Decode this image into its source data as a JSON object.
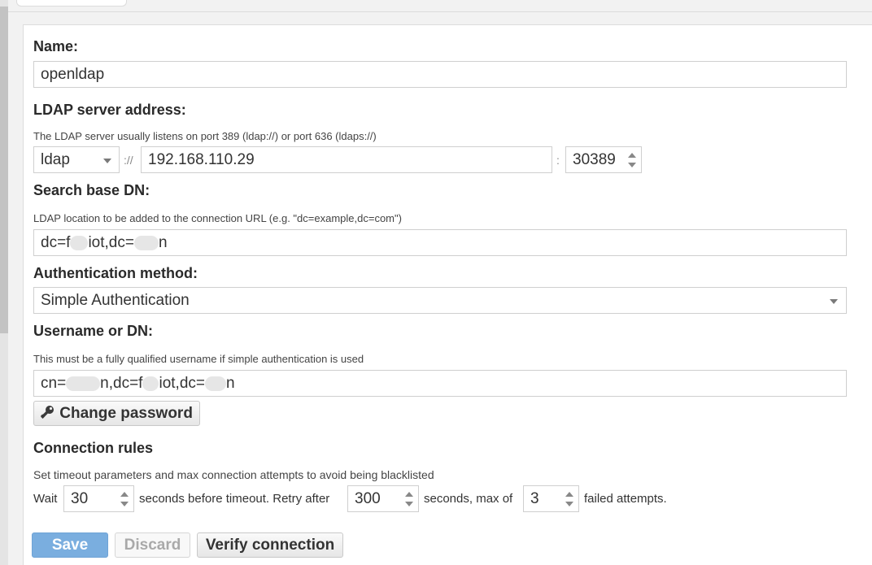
{
  "form": {
    "name_label": "Name:",
    "name_value": "openldap",
    "server_label": "LDAP server address:",
    "server_hint": "The LDAP server usually listens on port 389 (ldap://) or port 636 (ldaps://)",
    "protocol_value": "ldap",
    "protocol_sep": "://",
    "host_value": "192.168.110.29",
    "port_sep": ":",
    "port_value": "30389",
    "base_dn_label": "Search base DN:",
    "base_dn_hint": "LDAP location to be added to the connection URL (e.g. \"dc=example,dc=com\")",
    "base_dn_parts": [
      "dc=f",
      "iot,dc=",
      "n"
    ],
    "auth_label": "Authentication method:",
    "auth_value": "Simple Authentication",
    "username_label": "Username or DN:",
    "username_hint": "This must be a fully qualified username if simple authentication is used",
    "username_parts": [
      "cn=",
      "n,dc=f",
      "iot,dc=",
      "n"
    ],
    "change_password_label": "Change password"
  },
  "connection_rules": {
    "title": "Connection rules",
    "hint": "Set timeout parameters and max connection attempts to avoid being blacklisted",
    "wait_label": "Wait",
    "timeout_value": "30",
    "after_timeout_text": "seconds before timeout. Retry after",
    "retry_value": "300",
    "after_retry_text": "seconds, max of",
    "attempts_value": "3",
    "after_attempts_text": "failed attempts."
  },
  "actions": {
    "save_label": "Save",
    "discard_label": "Discard",
    "verify_label": "Verify connection"
  },
  "colors": {
    "primary_button": "#7aaedf",
    "panel_background": "#ffffff",
    "page_background": "#f2f2f2"
  },
  "icons": {
    "change_password": "key-icon"
  }
}
